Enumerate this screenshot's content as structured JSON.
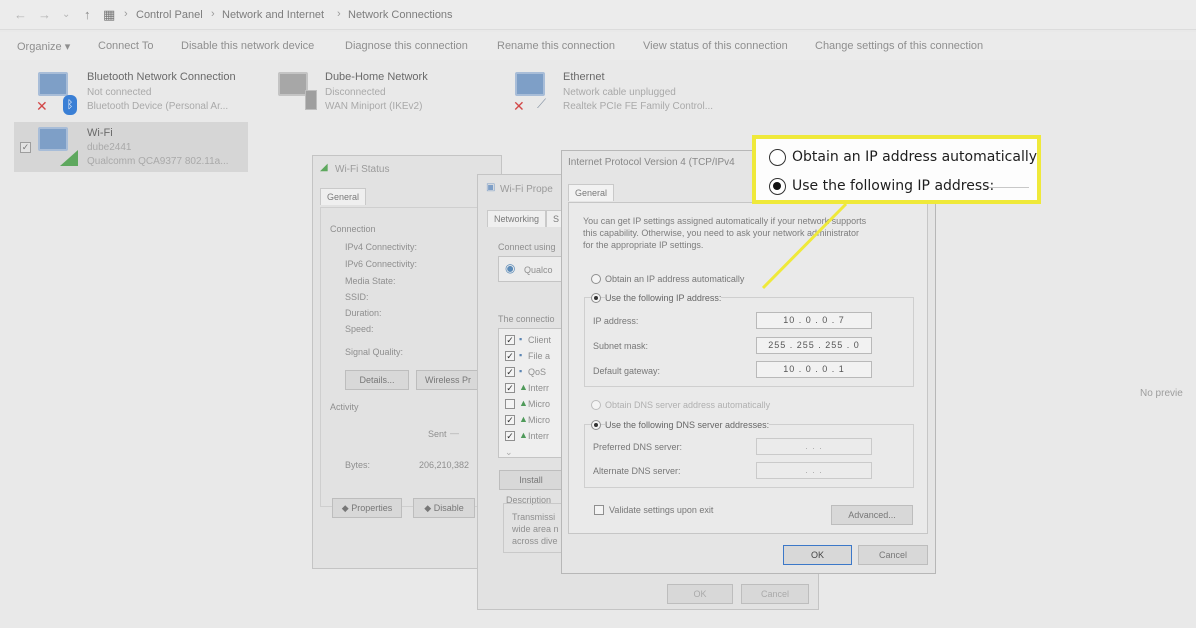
{
  "breadcrumb": [
    "Control Panel",
    "Network and Internet",
    "Network Connections"
  ],
  "toolbar": {
    "organize": "Organize ▾",
    "connect_to": "Connect To",
    "disable": "Disable this network device",
    "diagnose": "Diagnose this connection",
    "rename": "Rename this connection",
    "view_status": "View status of this connection",
    "change_settings": "Change settings of this connection"
  },
  "adapters": [
    {
      "name": "Bluetooth Network Connection",
      "status": "Not connected",
      "device": "Bluetooth Device (Personal Ar..."
    },
    {
      "name": "Dube-Home Network",
      "status": "Disconnected",
      "device": "WAN Miniport (IKEv2)"
    },
    {
      "name": "Ethernet",
      "status": "Network cable unplugged",
      "device": "Realtek PCIe FE Family Control..."
    },
    {
      "name": "Wi-Fi",
      "status": "dube2441",
      "device": "Qualcomm QCA9377 802.11a..."
    }
  ],
  "no_preview": "No previe",
  "wifi_status": {
    "title": "Wi-Fi Status",
    "tab": "General",
    "connection_label": "Connection",
    "rows": [
      "IPv4 Connectivity:",
      "IPv6 Connectivity:",
      "Media State:",
      "SSID:",
      "Duration:",
      "Speed:"
    ],
    "signal": "Signal Quality:",
    "details_btn": "Details...",
    "wireless_btn": "Wireless Pr",
    "activity": "Activity",
    "sent": "Sent",
    "bytes_label": "Bytes:",
    "bytes_value": "206,210,382",
    "properties_btn": "Properties",
    "disable_btn": "Disable"
  },
  "wifi_props": {
    "title": "Wi-Fi Prope",
    "tab_networking": "Networking",
    "tab_s": "S",
    "connect_using": "Connect using",
    "adapter": "Qualco",
    "items_label": "The connectio",
    "items": [
      "Client",
      "File a",
      "QoS",
      "Interr",
      "Micro",
      "Micro",
      "Interr"
    ],
    "install_btn": "Install",
    "description": "Description",
    "desc_text": [
      "Transmissi",
      "wide area n",
      "across dive"
    ],
    "ok": "OK",
    "cancel": "Cancel"
  },
  "ipv4": {
    "title": "Internet Protocol Version 4 (TCP/IPv4",
    "tab": "General",
    "intro": [
      "You can get IP settings assigned automatically if your network supports",
      "this capability. Otherwise, you need to ask your network administrator",
      "for the appropriate IP settings."
    ],
    "obtain_auto": "Obtain an IP address automatically",
    "use_following": "Use the following IP address:",
    "ip_label": "IP address:",
    "ip_value": "10 . 0 . 0 . 7",
    "subnet_label": "Subnet mask:",
    "subnet_value": "255 . 255 . 255 . 0",
    "gateway_label": "Default gateway:",
    "gateway_value": "10 . 0 . 0 . 1",
    "dns_auto": "Obtain DNS server address automatically",
    "dns_use": "Use the following DNS server addresses:",
    "preferred_dns": "Preferred DNS server:",
    "alternate_dns": "Alternate DNS server:",
    "dns_empty": ". . .",
    "validate": "Validate settings upon exit",
    "advanced": "Advanced...",
    "ok": "OK",
    "cancel": "Cancel"
  },
  "callout": {
    "obtain_auto": "Obtain an IP address automatically",
    "use_following": "Use the following IP address:",
    "color": "#efe93a"
  }
}
